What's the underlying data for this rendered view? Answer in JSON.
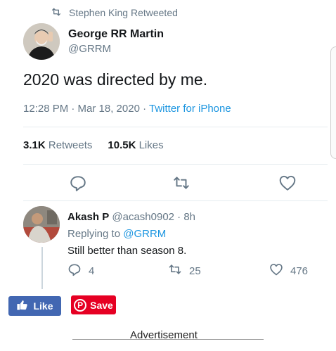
{
  "retweet": {
    "text": "Stephen King Retweeted",
    "icon": "retweet-icon"
  },
  "tweet": {
    "display_name": "George RR Martin",
    "handle": "@GRRM",
    "text": "2020 was directed by me.",
    "time": "12:28 PM · Mar 18, 2020 · ",
    "source": "Twitter for iPhone",
    "retweets_count": "3.1K",
    "retweets_label": "Retweets",
    "likes_count": "10.5K",
    "likes_label": "Likes"
  },
  "reply": {
    "display_name": "Akash P",
    "handle": "@acash0902 · 8h",
    "replying_prefix": "Replying to ",
    "replying_to": "@GRRM",
    "text": "Still better than season 8.",
    "reply_count": "4",
    "retweet_count": "25",
    "like_count": "476"
  },
  "share": {
    "like_label": "Like",
    "save_label": "Save",
    "facebook_color": "#4267b2",
    "pinterest_color": "#e60023"
  },
  "ad": {
    "label": "Advertisement"
  },
  "colors": {
    "link": "#1b95e0",
    "muted": "#657786",
    "text": "#14171a"
  }
}
